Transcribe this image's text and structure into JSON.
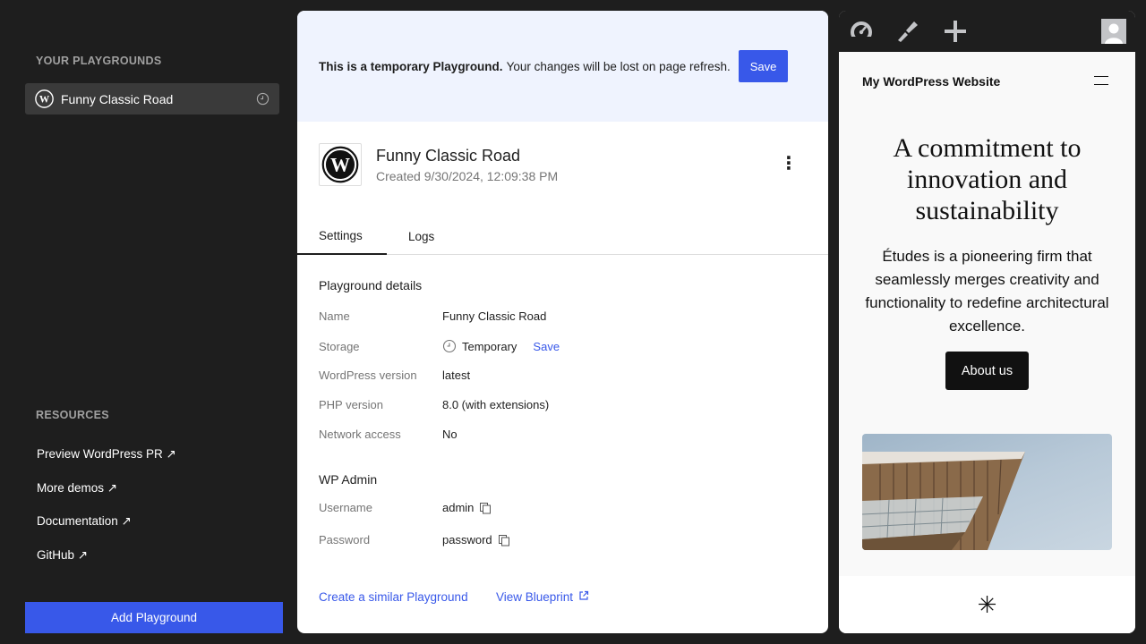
{
  "sidebar": {
    "heading": "YOUR PLAYGROUNDS",
    "playground_name": "Funny Classic Road",
    "resources_heading": "RESOURCES",
    "resources": [
      {
        "label": "Preview WordPress PR ↗"
      },
      {
        "label": "More demos ↗"
      },
      {
        "label": "Documentation ↗"
      },
      {
        "label": "GitHub ↗"
      }
    ],
    "add_button": "Add Playground"
  },
  "banner": {
    "bold": "This is a temporary Playground.",
    "text": "Your changes will be lost on page refresh.",
    "save_label": "Save"
  },
  "playground": {
    "title": "Funny Classic Road",
    "created": "Created 9/30/2024, 12:09:38 PM",
    "more_icon": "⋮"
  },
  "tabs": [
    {
      "label": "Settings",
      "active": true
    },
    {
      "label": "Logs",
      "active": false
    }
  ],
  "details": {
    "heading": "Playground details",
    "rows": [
      {
        "label": "Name",
        "value": "Funny Classic Road"
      },
      {
        "label": "Storage",
        "value": "Temporary",
        "action": "Save"
      },
      {
        "label": "WordPress version",
        "value": "latest"
      },
      {
        "label": "PHP version",
        "value": "8.0 (with extensions)"
      },
      {
        "label": "Network access",
        "value": "No"
      }
    ]
  },
  "wp_admin": {
    "heading": "WP Admin",
    "username_label": "Username",
    "username": "admin",
    "password_label": "Password",
    "password": "password"
  },
  "footer_links": {
    "similar": "Create a similar Playground",
    "blueprint": "View Blueprint"
  },
  "preview": {
    "site_title": "My WordPress Website",
    "hero_heading": "A commitment to innovation and sustainability",
    "hero_text": "Études is a pioneering firm that seamlessly merges creativity and functionality to redefine architectural excellence.",
    "about_button": "About us",
    "footer_glyph": "✳"
  },
  "colors": {
    "accent": "#3858e9",
    "sidebar_bg": "#1e1e1e",
    "banner_bg": "#eff3fe"
  }
}
